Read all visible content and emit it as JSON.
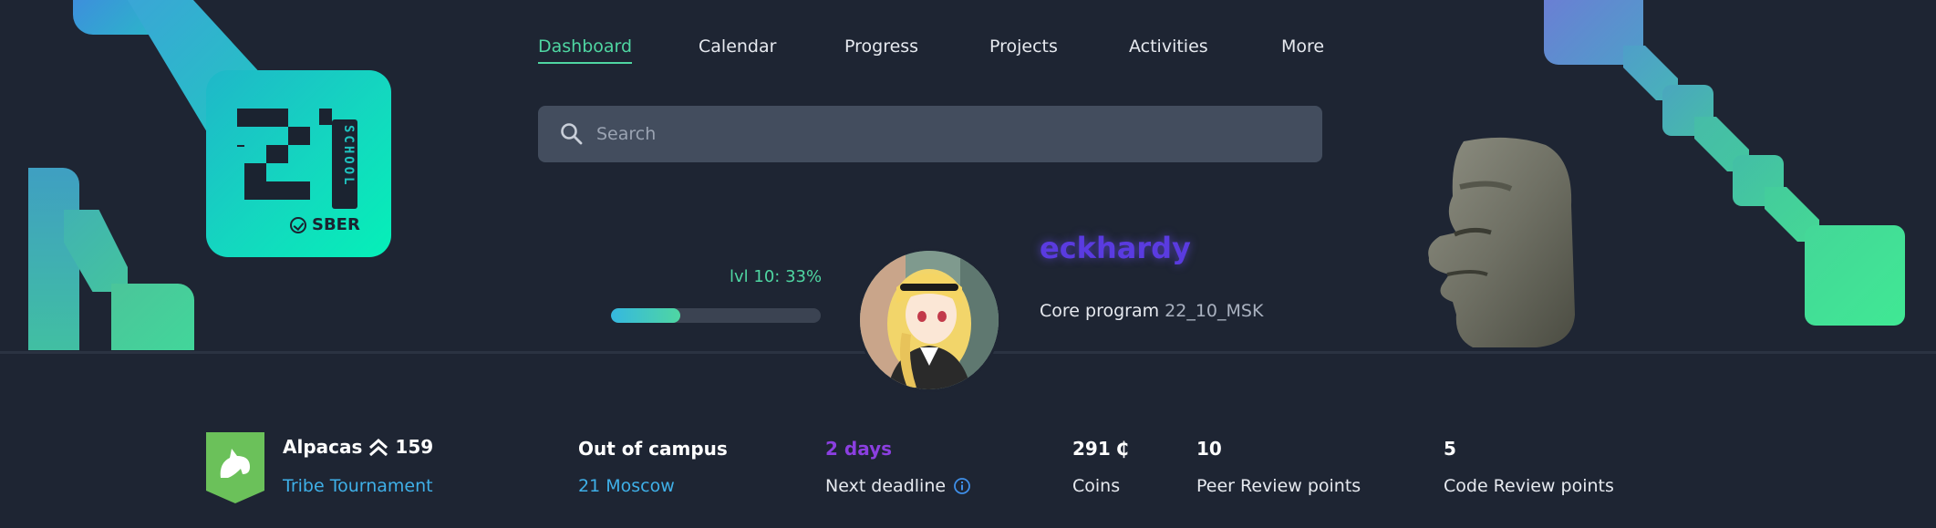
{
  "nav": {
    "items": [
      {
        "label": "Dashboard",
        "active": true
      },
      {
        "label": "Calendar",
        "active": false
      },
      {
        "label": "Progress",
        "active": false
      },
      {
        "label": "Projects",
        "active": false
      },
      {
        "label": "Activities",
        "active": false
      },
      {
        "label": "More",
        "active": false
      }
    ]
  },
  "search": {
    "placeholder": "Search"
  },
  "logo": {
    "school_mark": "SCHOOL",
    "brand": "SBER"
  },
  "profile": {
    "level_label": "lvl 10: 33%",
    "level_progress": 0.33,
    "username": "eckhardy",
    "program_label": "Core program",
    "program_code": "22_10_MSK"
  },
  "stats": {
    "tribe": {
      "name": "Alpacas",
      "points": "159",
      "subtitle": "Tribe Tournament"
    },
    "campus": {
      "title": "Out of campus",
      "subtitle": "21 Moscow"
    },
    "deadline": {
      "value": "2 days",
      "label": "Next deadline"
    },
    "coins": {
      "value": "291",
      "symbol": "₵",
      "label": "Coins"
    },
    "peer_review": {
      "value": "10",
      "label": "Peer Review points"
    },
    "code_review": {
      "value": "5",
      "label": "Code Review points"
    }
  },
  "colors": {
    "background": "#1e2533",
    "accent_green": "#4fd6a2",
    "link_blue": "#3fb0e8",
    "deadline_purple": "#8b3fe0",
    "username_purple": "#5a3be0"
  }
}
